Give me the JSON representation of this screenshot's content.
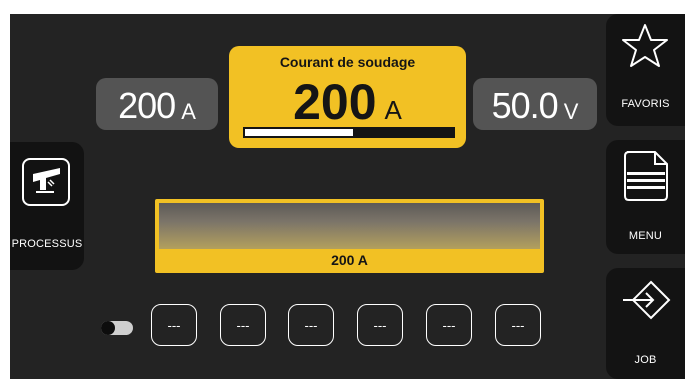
{
  "left_panel": {
    "process_label": "PROCESSUS"
  },
  "right_panel": {
    "favorites_label": "FAVORIS",
    "menu_label": "MENU",
    "job_label": "JOB"
  },
  "values": {
    "left": {
      "value": "200",
      "unit": "A"
    },
    "right": {
      "value": "50.0",
      "unit": "V"
    }
  },
  "center": {
    "title": "Courant de soudage",
    "value": "200",
    "unit": "A",
    "level_percent": 52
  },
  "graph": {
    "label": "200 A"
  },
  "memory_slots": [
    "---",
    "---",
    "---",
    "---",
    "---",
    "---"
  ],
  "toggle": {
    "state": "off"
  },
  "colors": {
    "accent": "#f2c124",
    "background": "#232323",
    "panel": "#131313",
    "value_box": "#545454"
  }
}
